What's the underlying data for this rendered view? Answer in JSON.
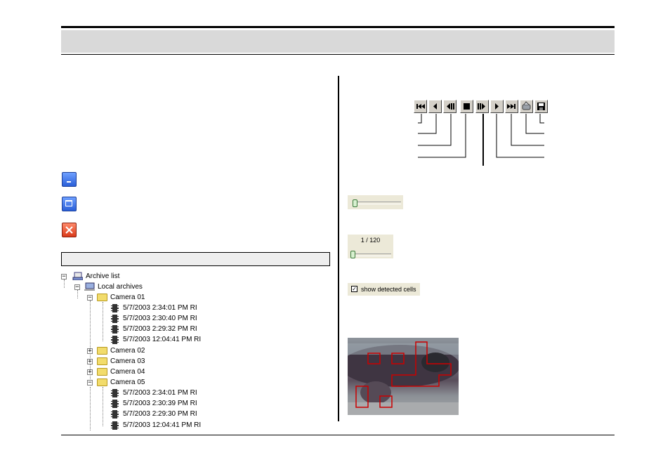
{
  "tree": {
    "root": "Archive list",
    "local": "Local archives",
    "cameras": [
      {
        "name": "Camera 01",
        "expanded": true,
        "entries": [
          "5/7/2003   2:34:01 PM  RI",
          "5/7/2003   2:30:40 PM  RI",
          "5/7/2003   2:29:32 PM  RI",
          "5/7/2003   12:04:41 PM  RI"
        ]
      },
      {
        "name": "Camera 02",
        "expanded": false,
        "entries": []
      },
      {
        "name": "Camera 03",
        "expanded": false,
        "entries": []
      },
      {
        "name": "Camera 04",
        "expanded": false,
        "entries": []
      },
      {
        "name": "Camera 05",
        "expanded": true,
        "entries": [
          "5/7/2003   2:34:01 PM  RI",
          "5/7/2003   2:30:39 PM  RI",
          "5/7/2003   2:29:30 PM  RI",
          "5/7/2003   12:04:41 PM  RI"
        ]
      }
    ]
  },
  "toolbar": {
    "buttons": [
      "go-to-start-icon",
      "play-backward-icon",
      "step-backward-icon",
      "stop-icon",
      "step-forward-icon",
      "play-forward-icon",
      "go-to-end-icon",
      "export-icon",
      "save-icon"
    ]
  },
  "frame_counter": "1 / 120",
  "checkbox_label": "show detected cells",
  "checkbox_checked": true,
  "colors": {
    "header_bar": "#d9d9d9",
    "detection_box": "#cc0000",
    "window_blue": "#2a5fd8",
    "window_red": "#d93a1a"
  }
}
